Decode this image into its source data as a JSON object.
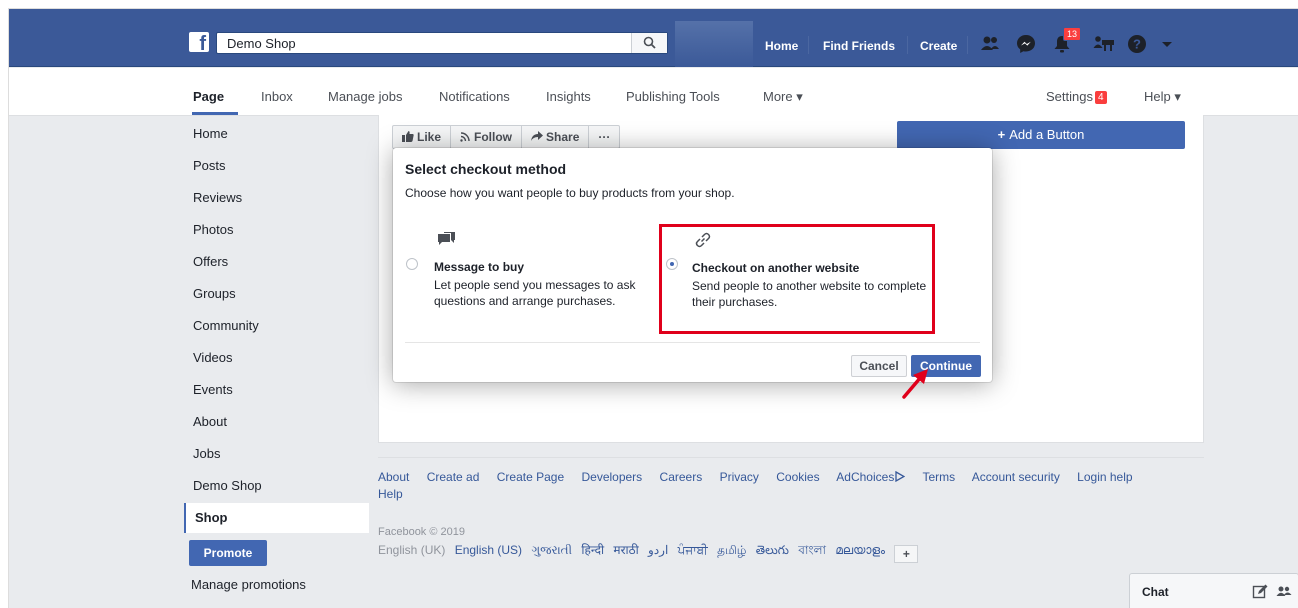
{
  "topbar": {
    "logo_letter": "f",
    "search_value": "Demo Shop",
    "search_placeholder": "Search",
    "nav": {
      "home": "Home",
      "find_friends": "Find Friends",
      "create": "Create"
    },
    "notifications_count": "13"
  },
  "subnav": {
    "tabs": [
      "Page",
      "Inbox",
      "Manage jobs",
      "Notifications",
      "Insights",
      "Publishing Tools",
      "More ▾"
    ],
    "settings": "Settings",
    "settings_badge": "4",
    "help": "Help ▾"
  },
  "sidebar": {
    "items": [
      "Home",
      "Posts",
      "Reviews",
      "Photos",
      "Offers",
      "Groups",
      "Community",
      "Videos",
      "Events",
      "About",
      "Jobs",
      "Demo Shop",
      "Shop"
    ],
    "active": "Shop",
    "promote": "Promote",
    "manage_promotions": "Manage promotions"
  },
  "page_actions": {
    "like": "Like",
    "follow": "Follow",
    "share": "Share",
    "more": "···",
    "add_button": "Add a Button"
  },
  "modal": {
    "title": "Select checkout method",
    "subtitle": "Choose how you want people to buy products from your shop.",
    "options": [
      {
        "title": "Message to buy",
        "desc": "Let people send you messages to ask questions and arrange purchases.",
        "selected": false,
        "icon": "message-icon"
      },
      {
        "title": "Checkout on another website",
        "desc": "Send people to another website to complete their purchases.",
        "selected": true,
        "icon": "link-icon"
      }
    ],
    "cancel": "Cancel",
    "continue": "Continue",
    "highlight_color": "#e0001b"
  },
  "footer": {
    "links": [
      "About",
      "Create ad",
      "Create Page",
      "Developers",
      "Careers",
      "Privacy",
      "Cookies",
      "AdChoices",
      "Terms",
      "Account security",
      "Login help",
      "Help"
    ],
    "copyright": "Facebook © 2019",
    "languages": [
      "English (UK)",
      "English (US)",
      "ગુજરાતી",
      "हिन्दी",
      "मराठी",
      "اردو",
      "ਪੰਜਾਬੀ",
      "தமிழ்",
      "తెలుగు",
      "বাংলা",
      "മലയാളം"
    ],
    "current_language": "English (UK)",
    "more_languages": "+"
  },
  "chat": {
    "label": "Chat"
  },
  "colors": {
    "brand": "#3b5998",
    "button": "#4267b2",
    "link": "#365899",
    "badge": "#fa3e3e"
  }
}
